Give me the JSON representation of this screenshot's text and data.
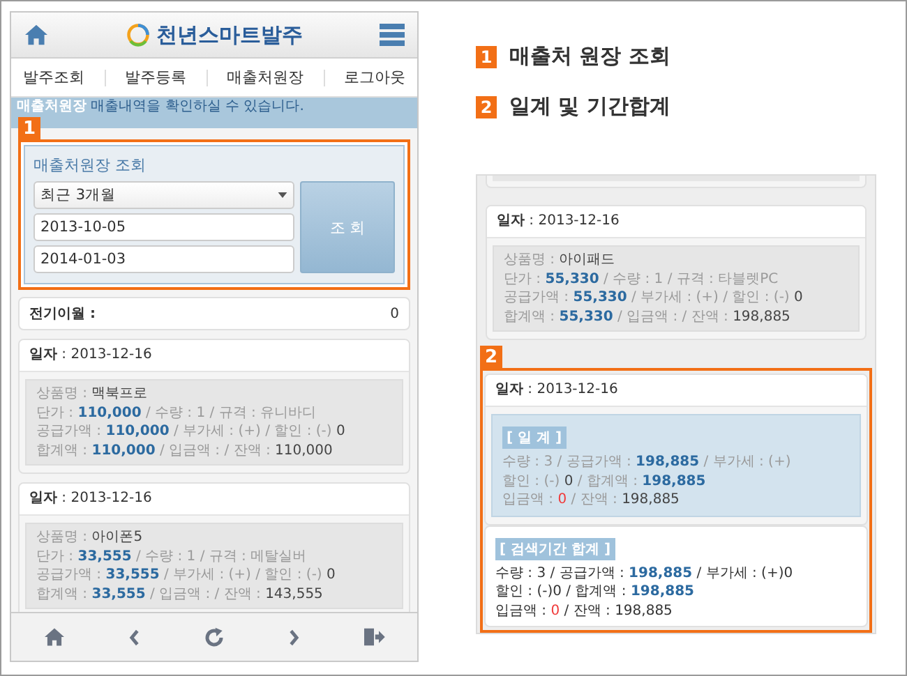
{
  "app": {
    "title": "천년스마트발주"
  },
  "menu": [
    "발주조회",
    "발주등록",
    "매출처원장",
    "로그아웃"
  ],
  "info_bar": {
    "title": "매출처원장",
    "message": "매출내역을 확인하실 수 있습니다."
  },
  "search": {
    "callout": "1",
    "heading": "매출처원장 조회",
    "period": "최근 3개월",
    "start_date": "2013-10-05",
    "end_date": "2014-01-03",
    "button": "조 회"
  },
  "balance": {
    "label": "전기이월 :",
    "value": "0"
  },
  "entries": [
    {
      "date": "**일자** : 2013-12-16",
      "lines": [
        [
          {
            "kind": "label",
            "text": "상품명 : "
          },
          {
            "kind": "value",
            "text": "맥북프로"
          }
        ],
        [
          {
            "kind": "label",
            "text": "단가 : "
          },
          {
            "kind": "amount",
            "text": "110,000"
          },
          {
            "kind": "label",
            "text": " / 수량 : 1 / 규격 : 유니바디"
          }
        ],
        [
          {
            "kind": "label",
            "text": "공급가액 : "
          },
          {
            "kind": "amount",
            "text": "110,000"
          },
          {
            "kind": "label",
            "text": " / 부가세 : (+) / 할인 : (-) "
          },
          {
            "kind": "value",
            "text": "0"
          }
        ],
        [
          {
            "kind": "label",
            "text": "합계액 : "
          },
          {
            "kind": "amount",
            "text": "110,000"
          },
          {
            "kind": "label",
            "text": " / 입금액 : / 잔액 : "
          },
          {
            "kind": "value",
            "text": "110,000"
          }
        ]
      ]
    },
    {
      "date": "**일자** : 2013-12-16",
      "lines": [
        [
          {
            "kind": "label",
            "text": "상품명 : "
          },
          {
            "kind": "value",
            "text": "아이폰5"
          }
        ],
        [
          {
            "kind": "label",
            "text": "단가 : "
          },
          {
            "kind": "amount",
            "text": "33,555"
          },
          {
            "kind": "label",
            "text": " / 수량 : 1 / 규격 : 메탈실버"
          }
        ],
        [
          {
            "kind": "label",
            "text": "공급가액 : "
          },
          {
            "kind": "amount",
            "text": "33,555"
          },
          {
            "kind": "label",
            "text": " / 부가세 : (+) / 할인 : (-) "
          },
          {
            "kind": "value",
            "text": "0"
          }
        ],
        [
          {
            "kind": "label",
            "text": "합계액 : "
          },
          {
            "kind": "amount",
            "text": "33,555"
          },
          {
            "kind": "label",
            "text": " / 입금액 : / 잔액 : "
          },
          {
            "kind": "value",
            "text": "143,555"
          }
        ]
      ]
    }
  ],
  "callouts": [
    {
      "number": "1",
      "label": "매출처 원장 조회"
    },
    {
      "number": "2",
      "label": "일계 및 기간합계"
    }
  ],
  "detail": {
    "callout": "2",
    "entries": [
      {
        "date": "**일자** : 2013-12-16",
        "lines": [
          [
            {
              "kind": "label",
              "text": "상품명 : "
            },
            {
              "kind": "value",
              "text": "아이패드"
            }
          ],
          [
            {
              "kind": "label",
              "text": "단가 : "
            },
            {
              "kind": "amount",
              "text": "55,330"
            },
            {
              "kind": "label",
              "text": " / 수량 : 1 / 규격 : 타블렛PC"
            }
          ],
          [
            {
              "kind": "label",
              "text": "공급가액 : "
            },
            {
              "kind": "amount",
              "text": "55,330"
            },
            {
              "kind": "label",
              "text": " / 부가세 : (+) / 할인 : (-) "
            },
            {
              "kind": "value",
              "text": "0"
            }
          ],
          [
            {
              "kind": "label",
              "text": "합계액 : "
            },
            {
              "kind": "amount",
              "text": "55,330"
            },
            {
              "kind": "label",
              "text": " / 입금액 : / 잔액 : "
            },
            {
              "kind": "value",
              "text": "198,885"
            }
          ]
        ]
      }
    ],
    "daily_total": {
      "date": "**일자** : 2013-12-16",
      "title": "[ 일 계 ]",
      "lines": [
        [
          {
            "kind": "label",
            "text": "수량 : 3 / 공급가액 : "
          },
          {
            "kind": "amount",
            "text": "198,885"
          },
          {
            "kind": "label",
            "text": " / 부가세 : (+)"
          }
        ],
        [
          {
            "kind": "label",
            "text": "할인 : (-) "
          },
          {
            "kind": "value",
            "text": "0"
          },
          {
            "kind": "label",
            "text": " / 합계액 : "
          },
          {
            "kind": "amount",
            "text": "198,885"
          }
        ],
        [
          {
            "kind": "label",
            "text": "입금액 : "
          },
          {
            "kind": "alert",
            "text": "0"
          },
          {
            "kind": "label",
            "text": " / 잔액 : "
          },
          {
            "kind": "value",
            "text": "198,885"
          }
        ]
      ]
    },
    "period_total": {
      "title": "[ 검색기간 합계 ]",
      "lines": [
        [
          {
            "kind": "text",
            "text": "수량 : 3 / 공급가액 : "
          },
          {
            "kind": "amount",
            "text": "198,885"
          },
          {
            "kind": "text",
            "text": " / 부가세 : (+)0"
          }
        ],
        [
          {
            "kind": "text",
            "text": "할인 : (-)0 / 합계액 : "
          },
          {
            "kind": "amount",
            "text": "198,885"
          }
        ],
        [
          {
            "kind": "text",
            "text": "입금액 : "
          },
          {
            "kind": "alert",
            "text": "0"
          },
          {
            "kind": "text",
            "text": " / 잔액 : 198,885"
          }
        ]
      ]
    }
  }
}
